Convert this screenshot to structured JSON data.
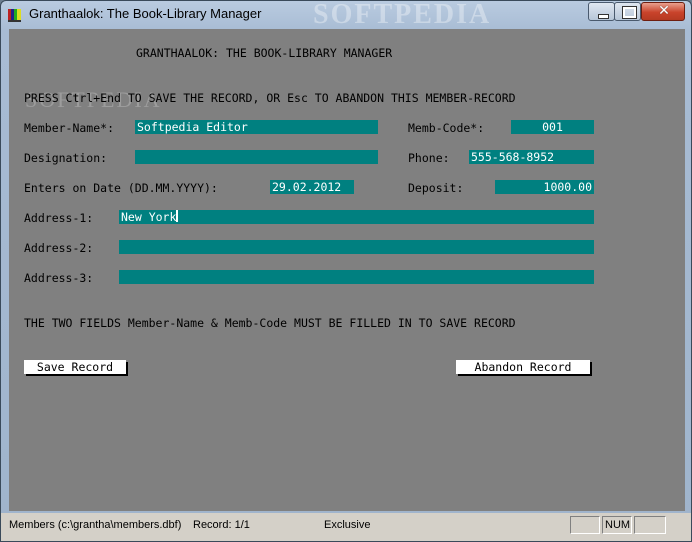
{
  "window": {
    "title": "Granthaalok: The Book-Library Manager",
    "watermark": "SOFTPEDIA",
    "close_glyph": "✕"
  },
  "form": {
    "heading": "GRANTHAALOK: THE BOOK-LIBRARY MANAGER",
    "instruction": "PRESS Ctrl+End TO SAVE THE RECORD, OR Esc TO ABANDON THIS MEMBER-RECORD",
    "watermark": "SOFTPEDIA",
    "member_name": {
      "label": "Member-Name*:",
      "value": "Softpedia Editor"
    },
    "memb_code": {
      "label": "Memb-Code*:",
      "value": "001"
    },
    "designation": {
      "label": "Designation:",
      "value": ""
    },
    "phone": {
      "label": "Phone:",
      "value": "555-568-8952"
    },
    "enters_on_date": {
      "label": "Enters on Date (DD.MM.YYYY):",
      "value": "29.02.2012"
    },
    "deposit": {
      "label": "Deposit:",
      "value": "1000.00"
    },
    "address1": {
      "label": "Address-1:",
      "value": "New York"
    },
    "address2": {
      "label": "Address-2:",
      "value": ""
    },
    "address3": {
      "label": "Address-3:",
      "value": ""
    },
    "note": "THE TWO FIELDS Member-Name & Memb-Code MUST BE FILLED IN TO SAVE RECORD",
    "save_button": "Save Record",
    "abandon_button": "Abandon Record"
  },
  "statusbar": {
    "file": "Members (c:\\grantha\\members.dbf)",
    "record": "Record: 1/1",
    "mode": "Exclusive",
    "num": "NUM"
  },
  "colors": {
    "client_bg": "#808080",
    "field_bg": "#008080"
  },
  "icons": {
    "app": "app-icon",
    "minimize": "minimize-icon",
    "maximize": "maximize-icon",
    "close": "close-icon"
  }
}
